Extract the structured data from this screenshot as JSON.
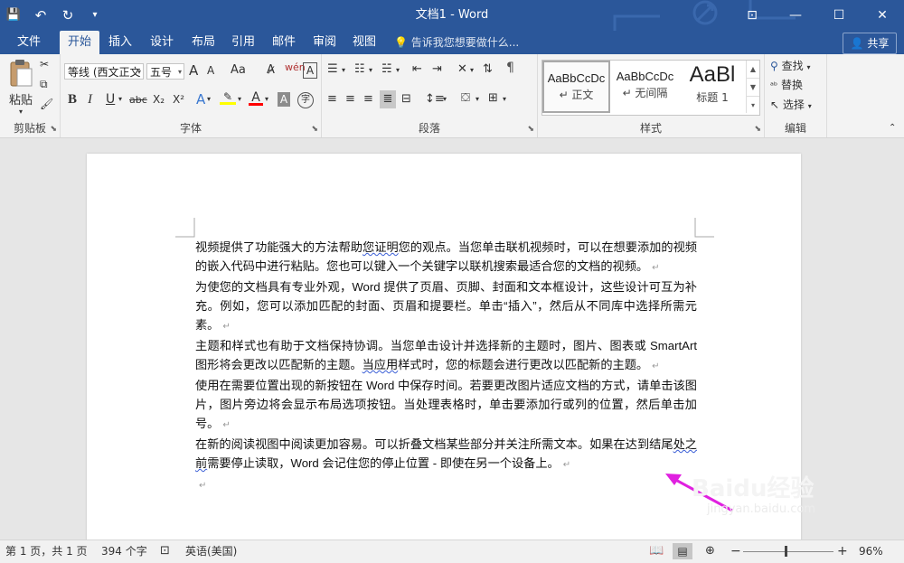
{
  "window": {
    "title": "文档1 - Word",
    "minimize": "—",
    "maximize": "☐",
    "close": "✕",
    "ribbon_display": "⊡"
  },
  "qat": {
    "save": "💾",
    "undo": "↶",
    "redo": "↻",
    "customize": "▾"
  },
  "tabs": [
    "文件",
    "开始",
    "插入",
    "设计",
    "布局",
    "引用",
    "邮件",
    "审阅",
    "视图"
  ],
  "active_tab": "开始",
  "tell_me": "告诉我您想要做什么...",
  "share": "共享",
  "ribbon": {
    "clipboard": {
      "paste": "粘贴",
      "label": "剪贴板"
    },
    "font": {
      "font_name": "等线 (西文正文",
      "font_size": "五号",
      "grow": "A",
      "shrink": "A",
      "change_case": "Aa",
      "bold": "B",
      "italic": "I",
      "underline": "U",
      "strike": "abc",
      "subscript": "X₂",
      "superscript": "X²",
      "label": "字体"
    },
    "paragraph": {
      "label": "段落"
    },
    "styles": {
      "items": [
        {
          "preview": "AaBbCcDc",
          "name": "↵ 正文"
        },
        {
          "preview": "AaBbCcDc",
          "name": "↵ 无间隔"
        },
        {
          "preview": "AaBl",
          "name": "标题 1"
        }
      ],
      "label": "样式"
    },
    "editing": {
      "find": "查找",
      "replace": "替换",
      "select": "选择",
      "label": "编辑"
    }
  },
  "document": {
    "paragraphs": [
      {
        "segments": [
          {
            "t": "视频提供了功能强大的方法帮助"
          },
          {
            "t": "您证明",
            "u": true
          },
          {
            "t": "您的观点。当您单击联机视频时，可以在想要添加的视频的嵌入代码中进行粘贴。您也可以键入一个关键字以联机搜索最适合您的文档的视频。"
          }
        ]
      },
      {
        "segments": [
          {
            "t": "为使您的文档具有专业外观，Word 提供了页眉、页脚、封面和文本框设计，这些设计可互为补充。例如，您可以添加匹配的封面、页眉和提要栏。单击“插入”，然后从不同库中选择所需元素。"
          }
        ]
      },
      {
        "segments": [
          {
            "t": "主题和样式也有助于文档保持协调。当您单击设计并选择新的主题时，图片、图表或 SmartArt 图形将会更改以匹配新的主题。"
          },
          {
            "t": "当应用",
            "u": true
          },
          {
            "t": "样式时，您的标题会进行更改以匹配新的主题。"
          }
        ]
      },
      {
        "segments": [
          {
            "t": "使用在需要位置出现的新按钮在 Word 中保存时间。若要更改图片适应文档的方式，请单击该图片，图片旁边将会显示布局选项按钮。当处理表格时，单击要添加行或列的位置，然后单击加号。"
          }
        ]
      },
      {
        "segments": [
          {
            "t": "在新的阅读视图中阅读更加容易。可以折叠文档某些部分并关注所需文本。如果在达到结尾"
          },
          {
            "t": "处之前",
            "u": true
          },
          {
            "t": "需要停止读取，Word 会记住您的停止位置 - 即使在另一个设备上。"
          }
        ]
      },
      {
        "segments": []
      }
    ],
    "paragraph_mark": "↵"
  },
  "watermark": {
    "logo": "Baidu经验",
    "url": "jingyan.baidu.com"
  },
  "statusbar": {
    "page": "第 1 页，共 1 页",
    "words": "394 个字",
    "language": "英语(美国)",
    "zoom": "96%",
    "zoom_out": "−",
    "zoom_in": "+"
  },
  "colors": {
    "accent": "#2b579a",
    "arrow": "#e020e0",
    "highlight": "#ffff00",
    "font_color": "#ff0000"
  }
}
